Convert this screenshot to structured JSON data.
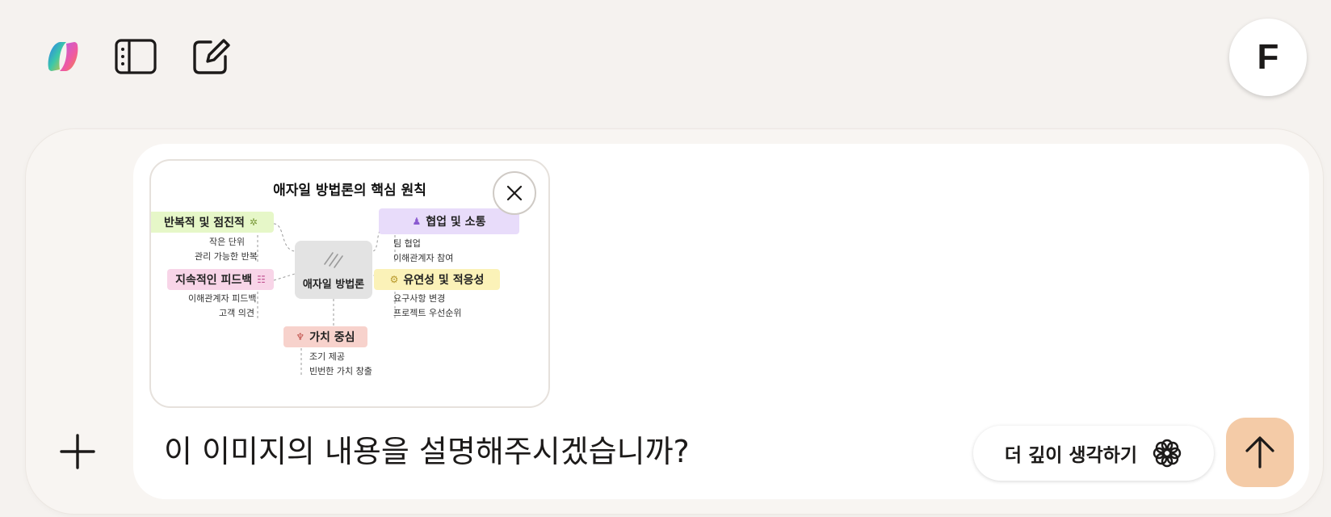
{
  "header": {
    "logo_icon": "copilot-logo-icon",
    "sidebar_toggle_icon": "sidebar-toggle-icon",
    "new_chat_icon": "new-chat-icon",
    "avatar_initial": "F"
  },
  "composer": {
    "attachment": {
      "close_icon": "close-icon",
      "mindmap": {
        "title": "애자일 방법론의 핵심 원칙",
        "center": "애자일 방법론",
        "branches": [
          {
            "label": "반복적 및 점진적",
            "color": "#e6f7c8",
            "items": [
              "작은 단위",
              "관리 가능한 반복"
            ]
          },
          {
            "label": "협업 및 소통",
            "color": "#e8dcfa",
            "items": [
              "팀 협업",
              "이해관계자 참여"
            ]
          },
          {
            "label": "지속적인 피드백",
            "color": "#f8d5e8",
            "items": [
              "이해관계자 피드백",
              "고객 의견"
            ]
          },
          {
            "label": "유연성 및 적응성",
            "color": "#fbf2b8",
            "items": [
              "요구사항 변경",
              "프로젝트 우선순위"
            ]
          },
          {
            "label": "가치 중심",
            "color": "#f7d2cc",
            "items": [
              "조기 제공",
              "빈번한 가치 창출"
            ]
          }
        ]
      }
    },
    "prompt_text": "이 이미지의 내용을 설명해주시겠습니까?",
    "think_deeper_label": "더 깊이 생각하기",
    "colors": {
      "send_button": "#f4cba7",
      "background": "#f5f2ef"
    }
  }
}
